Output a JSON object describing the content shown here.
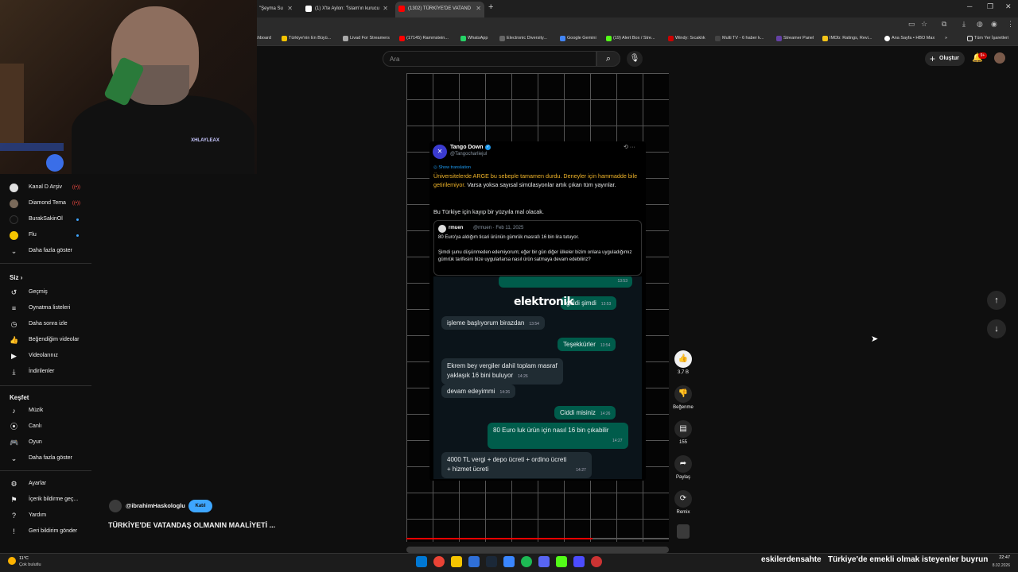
{
  "browser": {
    "tabs": [
      {
        "label": "\"Şeyma Su",
        "favicon_color": "#ff0000"
      },
      {
        "label": "(1) X'te Aylon: \"İslam'ın kurucu",
        "favicon_color": "#ffffff"
      },
      {
        "label": "(1302) TÜRKİYE'DE VATAND",
        "favicon_color": "#ff0000"
      }
    ],
    "new_tab": "+",
    "bookmarks": [
      {
        "label": "ashboard",
        "color": "#888888"
      },
      {
        "label": "Türkiye'nin En Büyü...",
        "color": "#f5c400"
      },
      {
        "label": "Livad For Streamers",
        "color": "#aaaaaa"
      },
      {
        "label": "(17145) Rammstein...",
        "color": "#ff0000"
      },
      {
        "label": "WhatsApp",
        "color": "#25d366"
      },
      {
        "label": "Electronic Diversity...",
        "color": "#666666"
      },
      {
        "label": "Google Gemini",
        "color": "#4285f4"
      },
      {
        "label": "(19) Alert Box / Stre...",
        "color": "#53fc18"
      },
      {
        "label": "Windy: Sıcaklık",
        "color": "#cc0000"
      },
      {
        "label": "Multi TV - 6 haber k...",
        "color": "#444444"
      },
      {
        "label": "Streamer Panel",
        "color": "#6441a5"
      },
      {
        "label": "IMDb: Ratings, Revi...",
        "color": "#f5c518"
      },
      {
        "label": "Ana Sayfa • HBO Max",
        "color": "#ffffff"
      },
      {
        "label": "Tüm Yer İşaretleri",
        "color": "#dddddd"
      }
    ],
    "more_bookmarks": "»"
  },
  "youtube": {
    "search_placeholder": "Ara",
    "create_label": "Oluştur",
    "notification_count": "9+"
  },
  "sidebar": {
    "subscriptions": [
      {
        "label": "Kanal D Arşiv",
        "color": "#e0e0e0",
        "badge": "live"
      },
      {
        "label": "Diamond Tema",
        "color": "#7a6a5a",
        "badge": "live"
      },
      {
        "label": "BurakSakinOl",
        "color": "#111111",
        "badge": "dot"
      },
      {
        "label": "Flu",
        "color": "#f5c400",
        "badge": "dot"
      }
    ],
    "show_more_1": "Daha fazla göster",
    "you_heading": "Siz",
    "you_items": [
      {
        "label": "Geçmiş",
        "icon": "history-icon"
      },
      {
        "label": "Oynatma listeleri",
        "icon": "playlist-icon"
      },
      {
        "label": "Daha sonra izle",
        "icon": "clock-icon"
      },
      {
        "label": "Beğendiğim videolar",
        "icon": "thumb-up-icon"
      },
      {
        "label": "Videolarınız",
        "icon": "video-icon"
      },
      {
        "label": "İndirilenler",
        "icon": "download-icon"
      }
    ],
    "explore_heading": "Keşfet",
    "explore_items": [
      {
        "label": "Müzik",
        "icon": "music-icon"
      },
      {
        "label": "Canlı",
        "icon": "live-icon"
      },
      {
        "label": "Oyun",
        "icon": "gaming-icon"
      }
    ],
    "show_more_2": "Daha fazla göster",
    "settings_items": [
      {
        "label": "Ayarlar",
        "icon": "gear-icon"
      },
      {
        "label": "İçerik bildirme geç...",
        "icon": "flag-icon"
      },
      {
        "label": "Yardım",
        "icon": "help-icon"
      },
      {
        "label": "Geri bildirim gönder",
        "icon": "feedback-icon"
      }
    ]
  },
  "video": {
    "channel": "@ibrahimHaskologlu",
    "join_label": "Katıl",
    "title": "TÜRKİYE'DE VATANDAŞ OLMANIN MAALİYETİ ...",
    "progress_fraction": 0.71
  },
  "tweet": {
    "name": "Tango Down",
    "handle": "@Tangocharliejul",
    "show_translation": "Show translation",
    "body_highlight": "Üniversitelerde ARGE bu sebeple tamamen durdu. Deneyler için hammadde bile getirilemiyor.",
    "body_rest": " Varsa yoksa sayısal simülasyonlar artık çıkan tüm yayınlar.",
    "body_line2": "Bu Türkiye için kayıp bir yüzyıla mal olacak.",
    "quote": {
      "name": "rmuen",
      "meta": "@rmuen · Feb 11, 2025",
      "text1": "80 Euro'ya aldığım ticari ürünün gümrük masrafı 16 bin lira tutuyor.",
      "text2": "Şimdi şunu düşünmeden edemiyorum; eğer bir gün diğer ülkeler bizim onlara uyguladığımız gümrük tarifesini bize uygularlarsa nasıl ürün satmaya devam edebiliriz?"
    }
  },
  "chat": {
    "overlay_word": "elektronik",
    "messages": [
      {
        "text": "",
        "time": "13:53",
        "dir": "out"
      },
      {
        "text": "geldi şimdi",
        "time": "13:53",
        "dir": "out"
      },
      {
        "text": "işleme başlıyorum birazdan",
        "time": "13:54",
        "dir": "in"
      },
      {
        "text": "Teşekkürler",
        "time": "13:54",
        "dir": "out"
      },
      {
        "text": "Ekrem bey vergiler dahil toplam masraf",
        "text2": "yaklaşık 16 bini buluyor",
        "time": "14:26",
        "dir": "in"
      },
      {
        "text": "devam edeyimmi",
        "time": "14:26",
        "dir": "in"
      },
      {
        "text": "Ciddi misiniz",
        "time": "14:26",
        "dir": "out"
      },
      {
        "text": "80 Euro luk ürün için nasıl 16 bin çıkabilir",
        "time": "14:27",
        "dir": "out"
      },
      {
        "text": "4000 TL vergi + depo ücreti + ordino ücreti",
        "text2": "+ hizmet ücreti",
        "time": "14:27",
        "dir": "in"
      }
    ]
  },
  "actions": {
    "likes": "3,7 B",
    "dislike": "Beğenme",
    "comments": "155",
    "share": "Paylaş",
    "remix": "Remix"
  },
  "webcam": {
    "patch_text": "XHLAYLEAX"
  },
  "taskbar": {
    "temp": "11°C",
    "weather": "Çok bulutlu",
    "ticker1": "eskilerdensahte",
    "ticker2": "Türkiye'de emekli olmak isteyenler buyrun",
    "time": "22:47",
    "date": "8.02.2026",
    "apps": [
      "#0078d4",
      "#ea4335",
      "#f5c400",
      "#2f6fd8",
      "#1b2838",
      "#1db954",
      "#5865f2",
      "#53fc18",
      "#4c4cff",
      "#3a86ff",
      "#cc3333"
    ]
  }
}
